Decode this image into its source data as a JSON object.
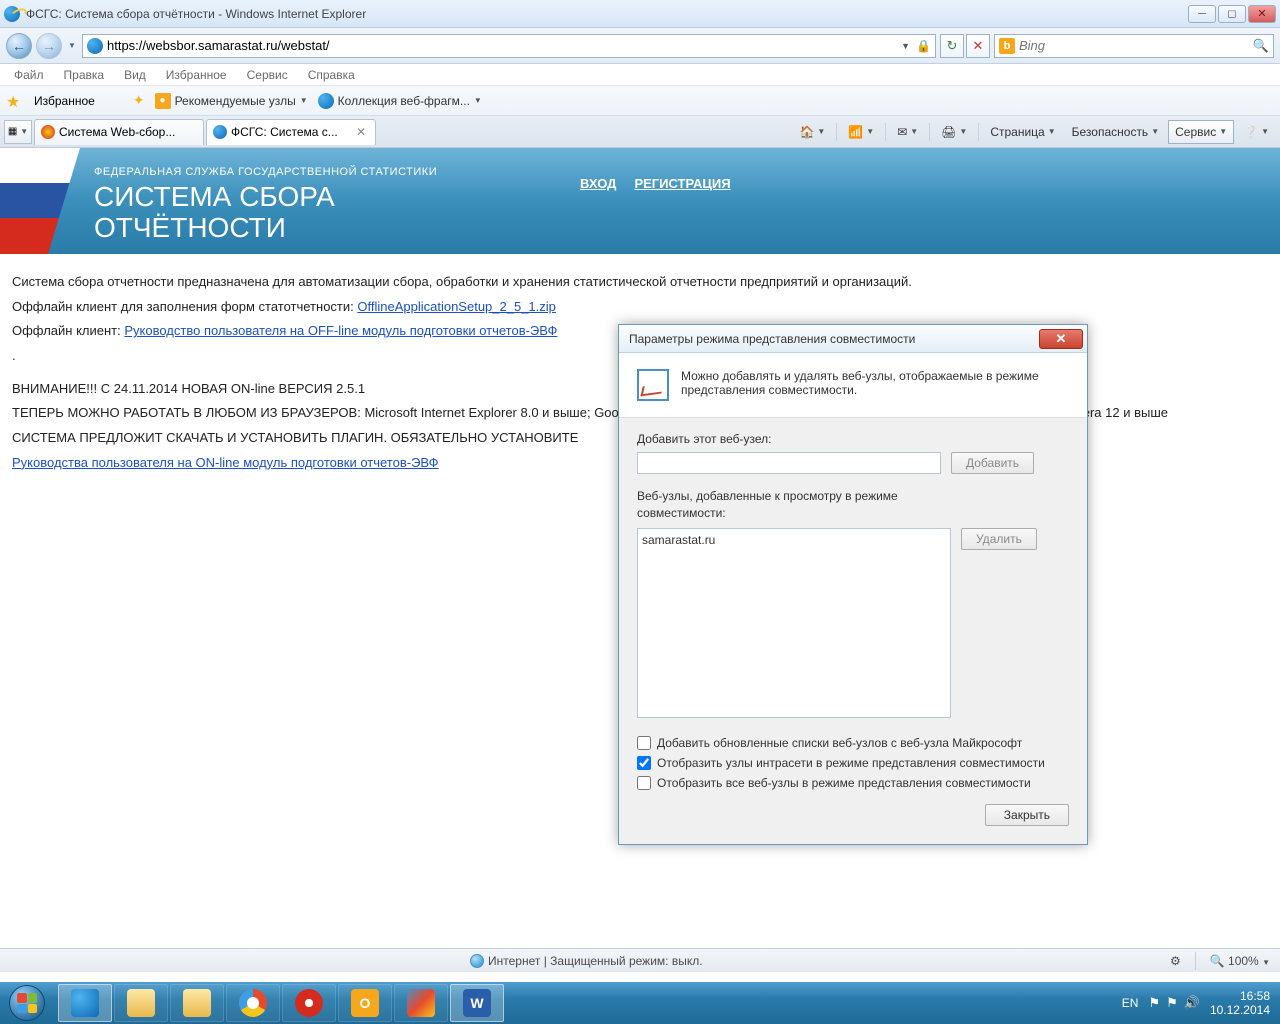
{
  "titlebar": {
    "title": "ФСГС: Система сбора отчётности - Windows Internet Explorer"
  },
  "navbar": {
    "url": "https://websbor.samarastat.ru/webstat/",
    "search_placeholder": "Bing"
  },
  "menubar": [
    "Файл",
    "Правка",
    "Вид",
    "Избранное",
    "Сервис",
    "Справка"
  ],
  "favbar": {
    "fav_label": "Избранное",
    "rec_label": "Рекомендуемые узлы",
    "coll_label": "Коллекция веб-фрагм..."
  },
  "tabs": {
    "tab1": "Система Web-сбор...",
    "tab2": "ФСГС: Система с..."
  },
  "toolbar": {
    "page": "Страница",
    "safety": "Безопасность",
    "service": "Сервис"
  },
  "banner": {
    "subtitle": "ФЕДЕРАЛЬНАЯ СЛУЖБА ГОСУДАРСТВЕННОЙ СТАТИСТИКИ",
    "title_l1": "СИСТЕМА СБОРА",
    "title_l2": "ОТЧЁТНОСТИ",
    "login": "ВХОД",
    "register": "РЕГИСТРАЦИЯ"
  },
  "content": {
    "p1": "Система сбора отчетности предназначена для автоматизации сбора, обработки и хранения статистической отчетности предприятий и организаций.",
    "p2a": "Оффлайн клиент для заполнения форм статотчетности: ",
    "p2link": "OfflineApplicationSetup_2_5_1.zip",
    "p3a": "Оффлайн клиент: ",
    "p3link": "Руководство пользователя на OFF-line модуль подготовки отчетов-ЭВФ",
    "dot": ".",
    "p4": "ВНИМАНИЕ!!! С 24.11.2014 НОВАЯ ON-line ВЕРСИЯ 2.5.1",
    "p5": "ТЕПЕРЬ МОЖНО РАБОТАТЬ В ЛЮБОМ ИЗ БРАУЗЕРОВ: Microsoft Internet Explorer 8.0 и выше; Goo",
    "p5tail": "erа 12 и выше",
    "p6": "СИСТЕМА ПРЕДЛОЖИТ СКАЧАТЬ И УСТАНОВИТЬ ПЛАГИН. ОБЯЗАТЕЛЬНО УСТАНОВИТЕ",
    "p7link": "Руководства пользователя на ON-line модуль подготовки отчетов-ЭВФ"
  },
  "dialog": {
    "title": "Параметры режима представления совместимости",
    "info": "Можно добавлять и удалять веб-узлы, отображаемые в режиме представления совместимости.",
    "add_label": "Добавить этот веб-узел:",
    "add_btn": "Добавить",
    "list_label": "Веб-узлы, добавленные к просмотру в режиме совместимости:",
    "list_item": "samarastat.ru",
    "del_btn": "Удалить",
    "chk1": "Добавить обновленные списки веб-узлов с веб-узла Майкрософт",
    "chk2": "Отобразить узлы интрасети в режиме представления совместимости",
    "chk3": "Отобразить все веб-узлы в режиме представления совместимости",
    "close_btn": "Закрыть"
  },
  "statusbar": {
    "text": "Интернет | Защищенный режим: выкл.",
    "zoom": "100%"
  },
  "tray": {
    "lang": "EN",
    "time": "16:58",
    "date": "10.12.2014"
  }
}
